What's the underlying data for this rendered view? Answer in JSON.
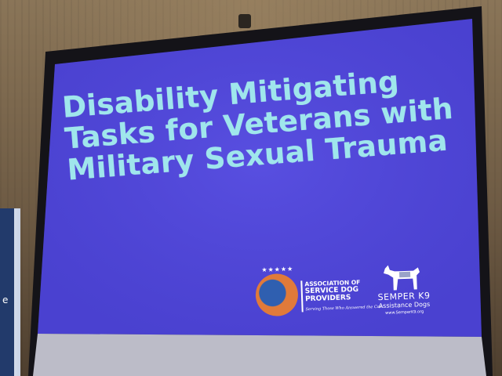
{
  "slide": {
    "title_lines": [
      "Disability Mitigating",
      "Tasks for Veterans with",
      "Military Sexual Trauma"
    ],
    "title_color": "#9fe6ec",
    "background_color": "#4f46d8"
  },
  "logos": {
    "asdp": {
      "line1": "ASSOCIATION OF",
      "line2": "SERVICE DOG",
      "line3": "PROVIDERS",
      "tagline": "Serving Those Who Answered the Call",
      "stars": "★★★★★"
    },
    "semper_k9": {
      "name": "SEMPER K9",
      "subtitle": "Assistance Dogs",
      "url": "www.SemperK9.org"
    }
  },
  "left_banner": {
    "glyph": "e"
  }
}
